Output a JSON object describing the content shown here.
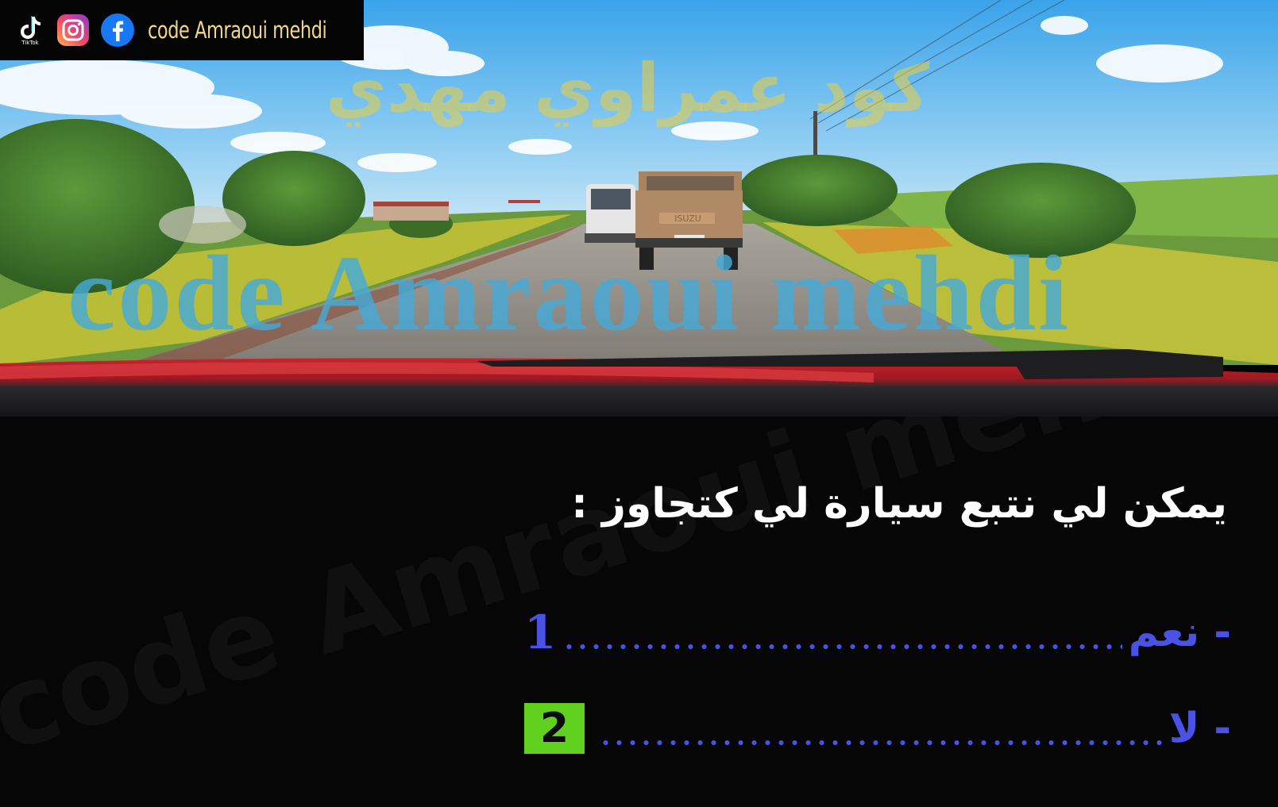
{
  "social_banner": {
    "tiktok_caption": "TikTok",
    "channel_name": "code Amraoui mehdi",
    "icons": [
      "tiktok-icon",
      "instagram-icon",
      "facebook-icon"
    ]
  },
  "scene": {
    "watermark_arabic": "كود عمراوي مهدي",
    "watermark_latin": "code Amraoui mehdi",
    "truck_plate_text": "ISUZU"
  },
  "quiz": {
    "background_watermark": "code Amraoui mehdi",
    "question": "يمكن لي نتبع سيارة لي كتجاوز :",
    "answers": [
      {
        "number": "1",
        "label": "- نعم",
        "selected": false
      },
      {
        "number": "2",
        "label": "- لا",
        "selected": true
      }
    ],
    "colors": {
      "answer_text": "#4a52e6",
      "selected_badge": "#5fd11e",
      "question_text": "#ffffff"
    }
  }
}
